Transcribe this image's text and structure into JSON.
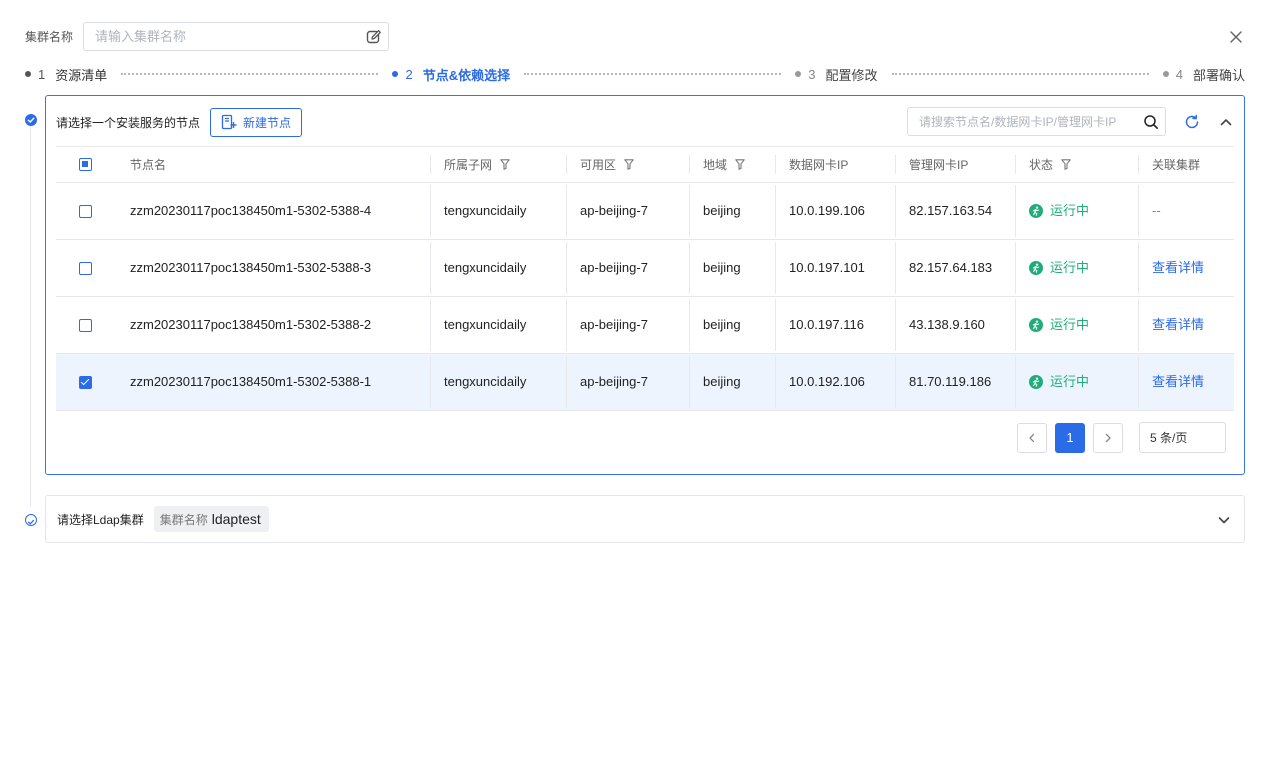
{
  "top": {
    "cluster_label": "集群名称",
    "cluster_placeholder": "请输入集群名称",
    "cluster_value": ""
  },
  "steps": [
    {
      "num": "1",
      "label": "资源清单",
      "state": "done"
    },
    {
      "num": "2",
      "label": "节点&依赖选择",
      "state": "active"
    },
    {
      "num": "3",
      "label": "配置修改",
      "state": "future"
    },
    {
      "num": "4",
      "label": "部署确认",
      "state": "future"
    }
  ],
  "node_panel": {
    "title": "请选择一个安装服务的节点",
    "new_button": "新建节点",
    "search_placeholder": "请搜索节点名/数据网卡IP/管理网卡IP",
    "columns": {
      "name": "节点名",
      "subnet": "所属子网",
      "zone": "可用区",
      "region": "地域",
      "data_ip": "数据网卡IP",
      "mgmt_ip": "管理网卡IP",
      "status": "状态",
      "cluster": "关联集群"
    },
    "rows": [
      {
        "name": "zzm20230117poc138450m1-5302-5388-4",
        "subnet": "tengxuncidaily",
        "zone": "ap-beijing-7",
        "region": "beijing",
        "data_ip": "10.0.199.106",
        "mgmt_ip": "82.157.163.54",
        "status": "运行中",
        "cluster": "--",
        "checked": false
      },
      {
        "name": "zzm20230117poc138450m1-5302-5388-3",
        "subnet": "tengxuncidaily",
        "zone": "ap-beijing-7",
        "region": "beijing",
        "data_ip": "10.0.197.101",
        "mgmt_ip": "82.157.64.183",
        "status": "运行中",
        "cluster": "查看详情",
        "checked": false
      },
      {
        "name": "zzm20230117poc138450m1-5302-5388-2",
        "subnet": "tengxuncidaily",
        "zone": "ap-beijing-7",
        "region": "beijing",
        "data_ip": "10.0.197.116",
        "mgmt_ip": "43.138.9.160",
        "status": "运行中",
        "cluster": "查看详情",
        "checked": false
      },
      {
        "name": "zzm20230117poc138450m1-5302-5388-1",
        "subnet": "tengxuncidaily",
        "zone": "ap-beijing-7",
        "region": "beijing",
        "data_ip": "10.0.192.106",
        "mgmt_ip": "81.70.119.186",
        "status": "运行中",
        "cluster": "查看详情",
        "checked": true
      }
    ],
    "pagination": {
      "current_page": "1",
      "page_size": "5 条/页"
    }
  },
  "ldap_panel": {
    "title": "请选择Ldap集群",
    "tag_key": "集群名称",
    "tag_value": "ldaptest"
  },
  "colors": {
    "accent": "#2b6be6",
    "running": "#1fae7a",
    "selected_row": "#eef4fe"
  }
}
